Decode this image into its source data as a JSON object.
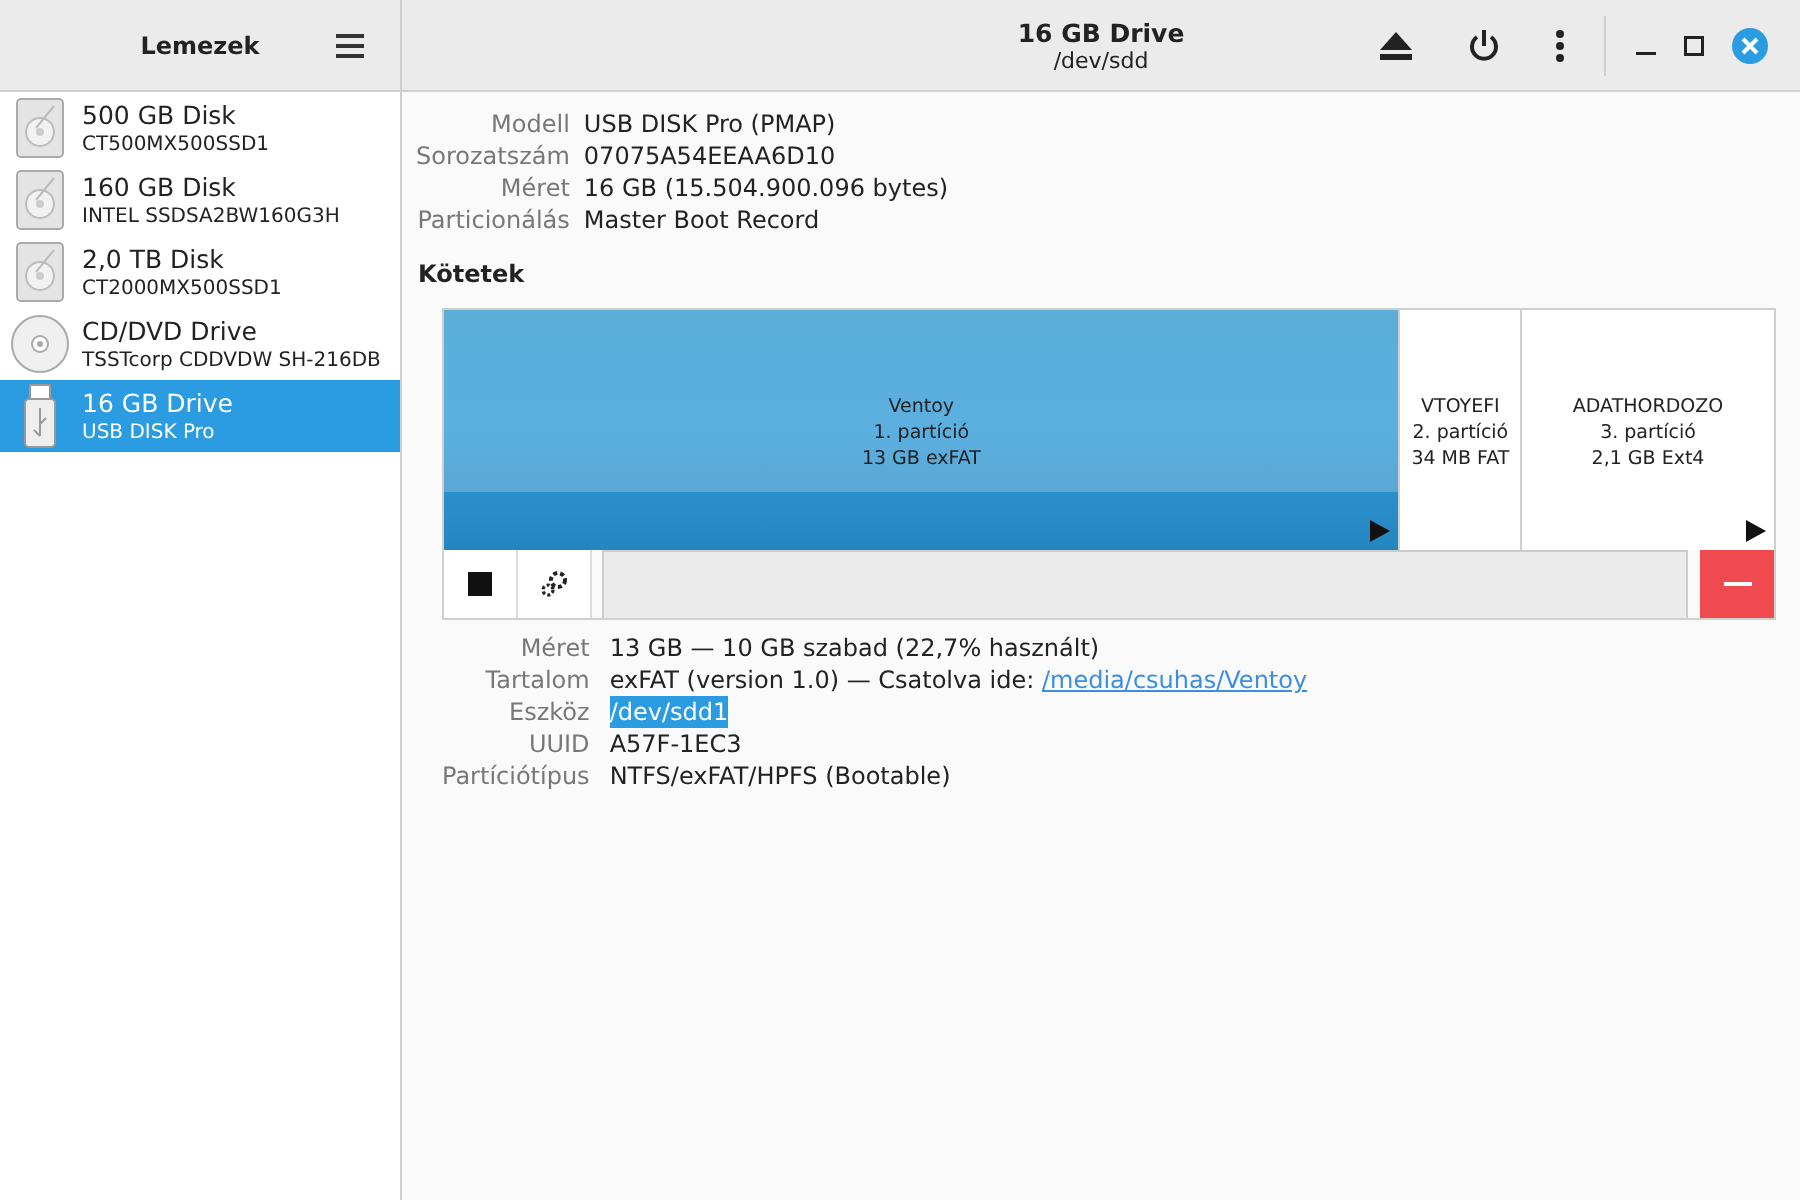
{
  "sidebar": {
    "title": "Lemezek",
    "items": [
      {
        "kind": "hdd",
        "name": "500 GB Disk",
        "model": "CT500MX500SSD1",
        "selected": false
      },
      {
        "kind": "hdd",
        "name": "160 GB Disk",
        "model": "INTEL SSDSA2BW160G3H",
        "selected": false
      },
      {
        "kind": "hdd",
        "name": "2,0 TB Disk",
        "model": "CT2000MX500SSD1",
        "selected": false
      },
      {
        "kind": "optical",
        "name": "CD/DVD Drive",
        "model": "TSSTcorp CDDVDW SH-216DB",
        "selected": false
      },
      {
        "kind": "usb",
        "name": "16 GB Drive",
        "model": "USB DISK Pro",
        "selected": true
      }
    ]
  },
  "header": {
    "title": "16 GB Drive",
    "subtitle": "/dev/sdd"
  },
  "drive_info": [
    {
      "label": "Modell",
      "value": "USB DISK Pro (PMAP)"
    },
    {
      "label": "Sorozatszám",
      "value": "07075A54EEAA6D10"
    },
    {
      "label": "Méret",
      "value": "16 GB (15.504.900.096 bytes)"
    },
    {
      "label": "Particionálás",
      "value": "Master Boot Record"
    }
  ],
  "volumes_heading": "Kötetek",
  "partitions": [
    {
      "name": "Ventoy",
      "number": "1. partíció",
      "size": "13 GB exFAT",
      "selected": true,
      "arrow": true
    },
    {
      "name": "VTOYEFI",
      "number": "2. partíció",
      "size": "34 MB FAT",
      "selected": false,
      "arrow": false
    },
    {
      "name": "ADATHORDOZO",
      "number": "3. partíció",
      "size": "2,1 GB Ext4",
      "selected": false,
      "arrow": true
    }
  ],
  "volume_info": [
    {
      "label": "Méret",
      "parts": [
        {
          "kind": "text",
          "text": "13 GB — 10 GB szabad (22,7% használt)"
        }
      ]
    },
    {
      "label": "Tartalom",
      "parts": [
        {
          "kind": "text",
          "text": "exFAT (version 1.0) — Csatolva ide: "
        },
        {
          "kind": "link",
          "text": "/media/csuhas/Ventoy"
        }
      ]
    },
    {
      "label": "Eszköz",
      "parts": [
        {
          "kind": "highlighted",
          "text": "/dev/sdd1"
        }
      ]
    },
    {
      "label": "UUID",
      "parts": [
        {
          "kind": "text",
          "text": "A57F-1EC3"
        }
      ]
    },
    {
      "label": "Partíciótípus",
      "parts": [
        {
          "kind": "text",
          "text": "NTFS/exFAT/HPFS (Bootable)"
        }
      ]
    }
  ]
}
